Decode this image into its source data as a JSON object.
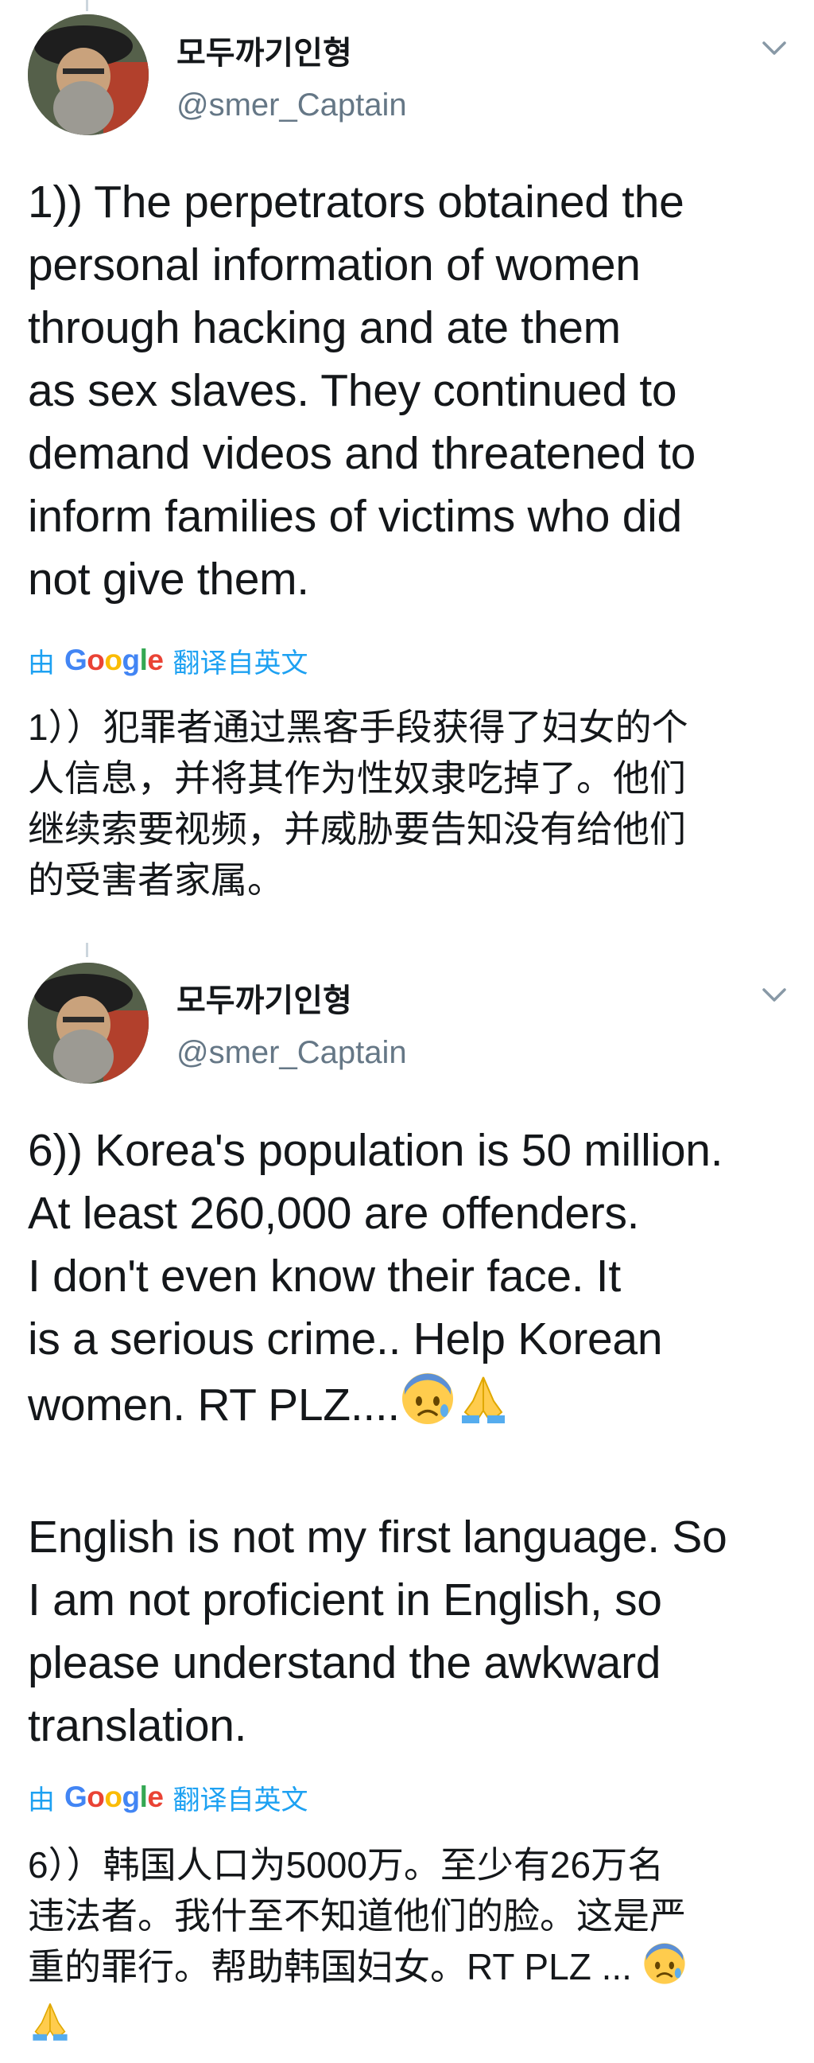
{
  "tweets": [
    {
      "display_name": "모두까기인형",
      "handle": "@smer_Captain",
      "text": "1)) The perpetrators obtained the\npersonal information of women\nthrough hacking and ate them\nas sex slaves. They continued to\ndemand videos and threatened to\ninform families of victims who did\nnot give them.",
      "translate": {
        "prefix": "由",
        "brand": "Google",
        "suffix": "翻译自英文"
      },
      "translation": "1））犯罪者通过黑客手段获得了妇女的个\n人信息，并将其作为性奴隶吃掉了。他们\n继续索要视频，并威胁要告知没有给他们\n的受害者家属。"
    },
    {
      "display_name": "모두까기인형",
      "handle": "@smer_Captain",
      "text_lines": [
        "6)) Korea's population is 50 million.",
        "At least 260,000 are offenders.",
        "I don't even know their face. It",
        "is a serious crime.. Help Korean",
        "women. RT PLZ....",
        "",
        "English is not my first language. So",
        "I am not proficient in English, so",
        "please understand the awkward",
        "translation."
      ],
      "translate": {
        "prefix": "由",
        "brand": "Google",
        "suffix": "翻译自英文"
      },
      "translation_lines": [
        "6））韩国人口为5000万。至少有26万名",
        "违法者。我什至不知道他们的脸。这是严",
        "重的罪行。帮助韩国妇女。RT PLZ ... "
      ],
      "emojis": [
        "anxious-face-icon",
        "folded-hands-icon"
      ]
    }
  ],
  "colors": {
    "link": "#1da1f2",
    "secondary": "#657786",
    "text": "#14171a",
    "google_blue": "#4285f4",
    "google_red": "#ea4335",
    "google_yellow": "#fbbc05",
    "google_green": "#34a853"
  }
}
